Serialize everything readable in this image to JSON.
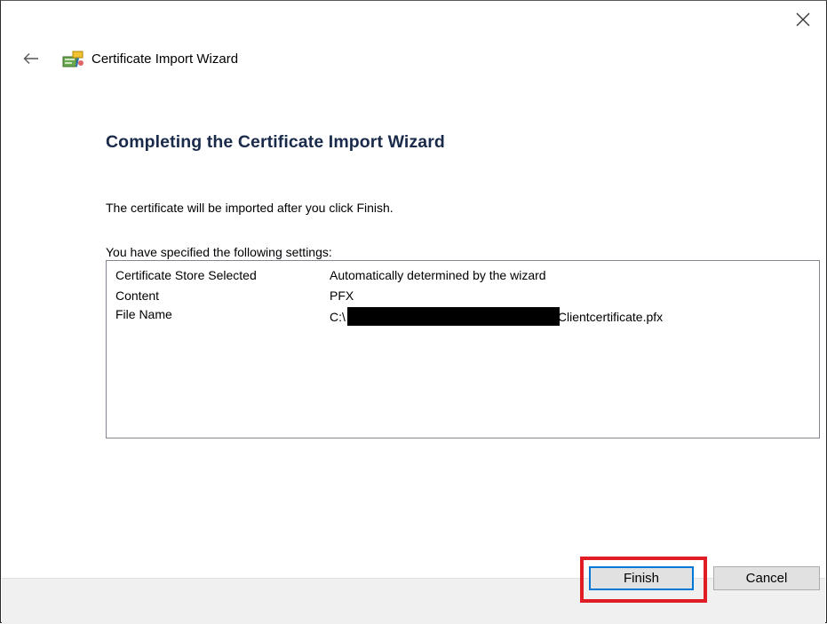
{
  "window": {
    "title": "Certificate Import Wizard",
    "close_icon": "close-icon",
    "back_icon": "back-arrow-icon",
    "wizard_icon": "certificate-wizard-icon"
  },
  "content": {
    "heading": "Completing the Certificate Import Wizard",
    "intro": "The certificate will be imported after you click Finish.",
    "settings_label": "You have specified the following settings:",
    "settings": [
      {
        "key": "Certificate Store Selected",
        "value": "Automatically determined by the wizard"
      },
      {
        "key": "Content",
        "value": "PFX"
      },
      {
        "key": "File Name",
        "value_prefix": "C:\\",
        "value_suffix": "Clientcertificate.pfx"
      }
    ]
  },
  "buttons": {
    "finish": "Finish",
    "cancel": "Cancel"
  },
  "colors": {
    "highlight": "#e01c25",
    "focus_border": "#0078d7",
    "heading": "#1a2a4a",
    "footer": "#f0f0f0"
  }
}
